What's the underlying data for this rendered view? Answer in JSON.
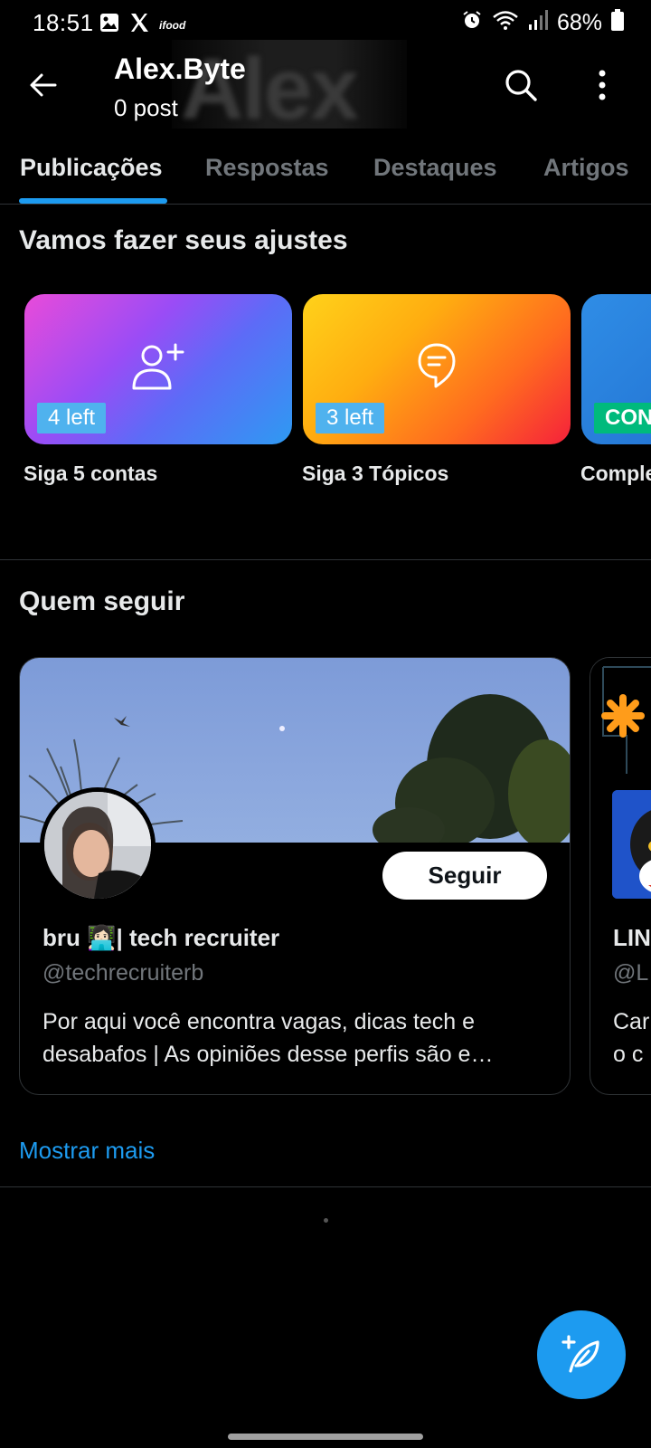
{
  "status_bar": {
    "time": "18:51",
    "battery": "68%",
    "left_icons": [
      "gallery-icon",
      "x-logo-icon",
      "ifood-icon"
    ],
    "right_icons": [
      "alarm-icon",
      "wifi-icon",
      "signal-icon",
      "battery-icon"
    ],
    "ifood_text": "ifood"
  },
  "header": {
    "title": "Alex.Byte",
    "subtitle": "0 post",
    "banner_text": "Alex"
  },
  "tabs": [
    {
      "label": "Publicações",
      "active": true
    },
    {
      "label": "Respostas",
      "active": false
    },
    {
      "label": "Destaques",
      "active": false
    },
    {
      "label": "Artigos",
      "active": false
    }
  ],
  "onboarding": {
    "title": "Vamos fazer seus ajustes",
    "cards": [
      {
        "label": "Siga 5 contas",
        "badge": "4 left",
        "icon": "add-user-icon"
      },
      {
        "label": "Siga 3 Tópicos",
        "badge": "3 left",
        "icon": "topic-icon"
      },
      {
        "label": "Comple",
        "badge": "CONC",
        "icon": "none"
      }
    ]
  },
  "who_to_follow": {
    "title": "Quem seguir",
    "cards": [
      {
        "name": "bru 👩🏻‍💻| tech recruiter",
        "handle": "@techrecruiterb",
        "bio": "Por aqui você encontra vagas, dicas tech e desabafos | As opiniões desse perfis são e…",
        "button": "Seguir"
      },
      {
        "name": "LIN",
        "handle": "@L",
        "bio_line1": "Car",
        "bio_line2": "o c"
      }
    ],
    "show_more": "Mostrar mais"
  },
  "colors": {
    "accent": "#1d9bf0",
    "background": "#000000",
    "text_primary": "#e7e9ea",
    "text_secondary": "#71767b",
    "divider": "#2f3336",
    "badge_green": "#00ba7c"
  },
  "fab": {
    "icon": "compose-post-icon"
  }
}
